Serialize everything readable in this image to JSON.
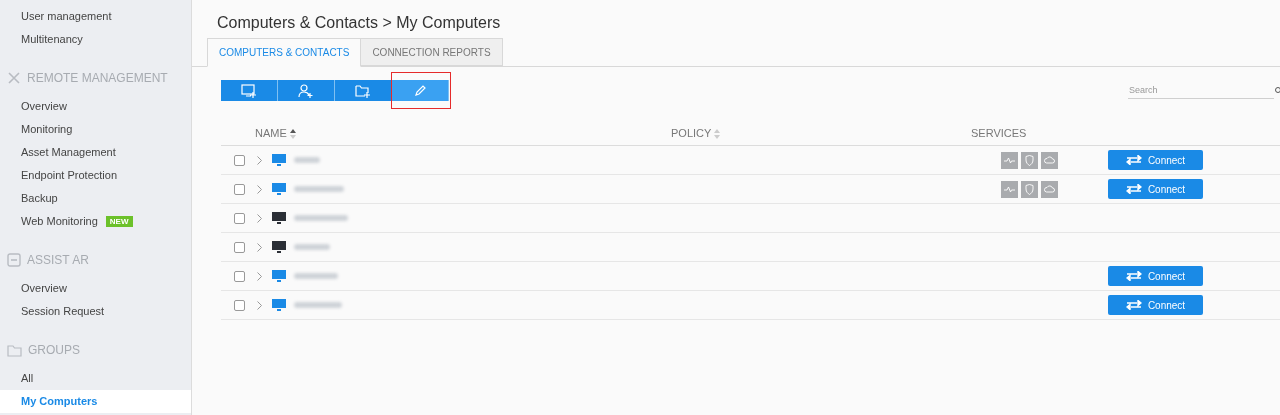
{
  "sidebar": {
    "top_items": [
      {
        "label": "User management",
        "selected": false
      },
      {
        "label": "Multitenancy",
        "selected": false
      }
    ],
    "sections": [
      {
        "kind": "remote",
        "title": "REMOTE MANAGEMENT",
        "items": [
          {
            "label": "Overview",
            "selected": false
          },
          {
            "label": "Monitoring",
            "selected": false
          },
          {
            "label": "Asset Management",
            "selected": false
          },
          {
            "label": "Endpoint Protection",
            "selected": false
          },
          {
            "label": "Backup",
            "selected": false
          },
          {
            "label": "Web Monitoring",
            "selected": false,
            "badge": "NEW"
          }
        ]
      },
      {
        "kind": "assist",
        "title": "ASSIST AR",
        "items": [
          {
            "label": "Overview",
            "selected": false
          },
          {
            "label": "Session Request",
            "selected": false
          }
        ]
      },
      {
        "kind": "groups",
        "title": "GROUPS",
        "items": [
          {
            "label": "All",
            "selected": false
          },
          {
            "label": "My Computers",
            "selected": true
          }
        ]
      }
    ]
  },
  "breadcrumb": "Computers & Contacts > My Computers",
  "tabs": [
    {
      "label": "COMPUTERS & CONTACTS",
      "selected": true
    },
    {
      "label": "CONNECTION REPORTS",
      "selected": false
    }
  ],
  "toolbar": [
    {
      "kind": "add-computer",
      "highlighted": false
    },
    {
      "kind": "add-contact",
      "highlighted": false
    },
    {
      "kind": "add-group",
      "highlighted": false
    },
    {
      "kind": "edit",
      "highlighted": true
    }
  ],
  "search": {
    "placeholder": "Search"
  },
  "table": {
    "columns": [
      {
        "label": "NAME",
        "sorted": true
      },
      {
        "label": "POLICY",
        "sorted": false
      },
      {
        "label": "SERVICES"
      }
    ],
    "rows": [
      {
        "checked": false,
        "online": true,
        "services": true,
        "connect": "Connect"
      },
      {
        "checked": false,
        "online": true,
        "services": true,
        "connect": "Connect"
      },
      {
        "checked": false,
        "online": false,
        "services": false
      },
      {
        "checked": false,
        "online": false,
        "services": false
      },
      {
        "checked": false,
        "online": true,
        "services": false,
        "connect": "Connect"
      },
      {
        "checked": false,
        "online": true,
        "services": false,
        "connect": "Connect"
      }
    ]
  }
}
